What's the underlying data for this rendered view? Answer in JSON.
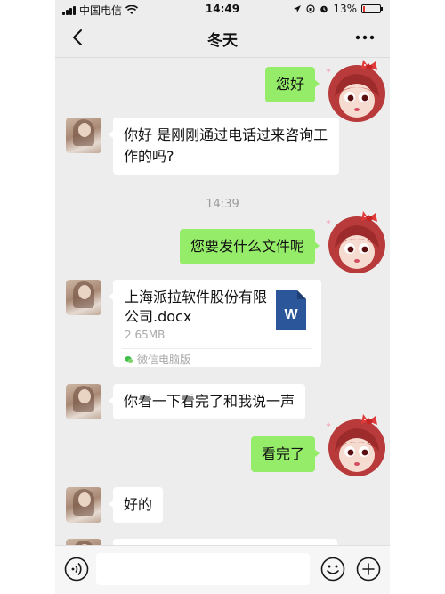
{
  "status_bar": {
    "carrier": "中国电信",
    "time": "14:49",
    "battery": "13%",
    "battery_level": 0.13,
    "battery_color": "#e0342e"
  },
  "nav": {
    "title": "冬天",
    "back_icon": "chevron-left-icon",
    "more_icon": "more-dots-icon"
  },
  "messages": [
    {
      "side": "right",
      "type": "text",
      "text": "您好"
    },
    {
      "side": "left",
      "type": "text",
      "text": "你好 是刚刚通过电话过来咨询工作的吗?"
    },
    {
      "type": "timestamp",
      "text": "14:39"
    },
    {
      "side": "right",
      "type": "text",
      "text": "您要发什么文件呢"
    },
    {
      "side": "left",
      "type": "file",
      "file_name": "上海派拉软件股份有限公司.docx",
      "file_size": "2.65MB",
      "source": "微信电脑版"
    },
    {
      "side": "left",
      "type": "text",
      "text": "你看一下看完了和我说一声"
    },
    {
      "side": "right",
      "type": "text",
      "text": "看完了"
    },
    {
      "side": "left",
      "type": "text",
      "text": "好的"
    }
  ],
  "input_bar": {
    "voice_icon": "voice-icon",
    "emoji_icon": "emoji-icon",
    "plus_icon": "plus-icon",
    "placeholder": ""
  },
  "colors": {
    "chat_background": "#ededed",
    "sent_bubble": "#95ec69",
    "received_bubble": "#ffffff",
    "word_blue": "#2b579a"
  }
}
